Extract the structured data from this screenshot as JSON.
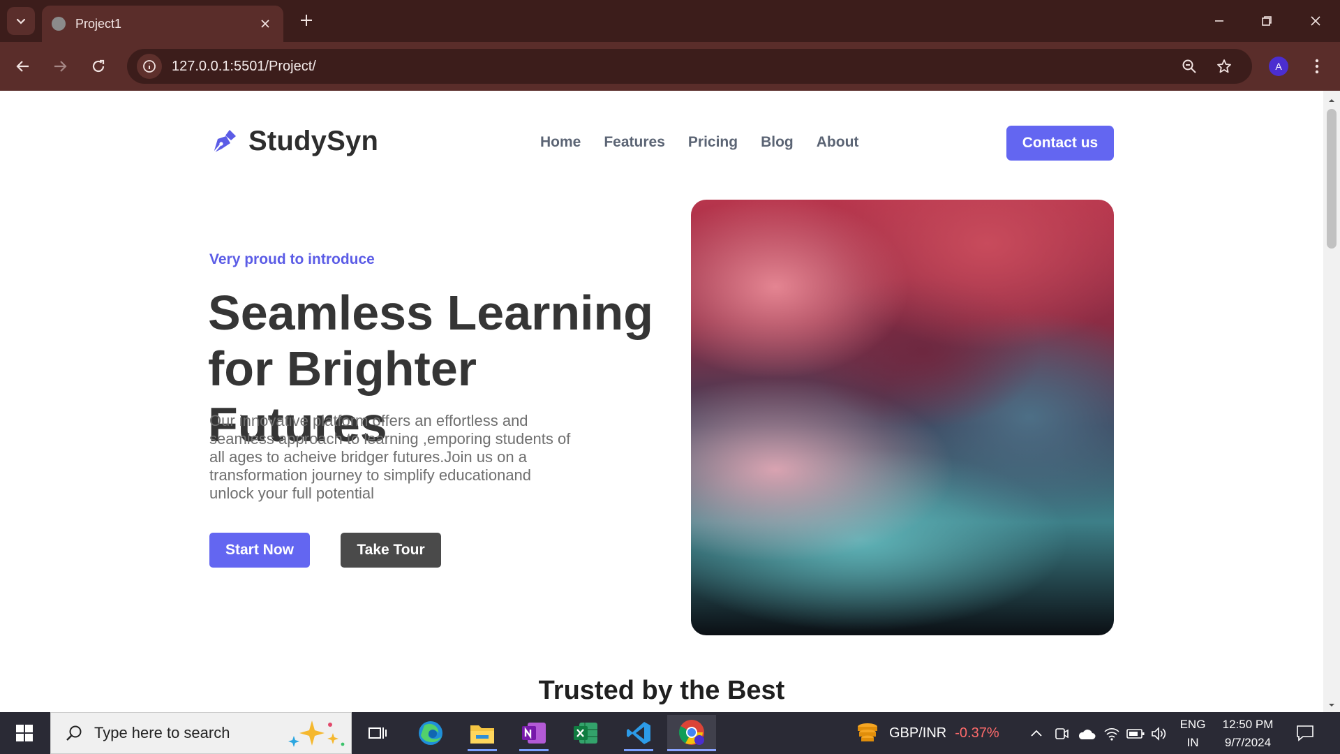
{
  "browser": {
    "tab_title": "Project1",
    "url": "127.0.0.1:5501/Project/",
    "profile_initial": "A"
  },
  "site": {
    "brand": "StudySyn",
    "nav": [
      "Home",
      "Features",
      "Pricing",
      "Blog",
      "About"
    ],
    "contact_label": "Contact us",
    "hero": {
      "eyebrow": "Very proud to introduce",
      "title_line1": "Seamless Learning",
      "title_line2": "for Brighter Futures",
      "description": "Our innovative platform offers an effortless and seamless approach to learning ,emporing students of all ages to acheive bridger futures.Join us on a transformation journey to simplify educationand unlock your full potential",
      "start_label": "Start Now",
      "tour_label": "Take Tour"
    },
    "section_title": "Trusted by the Best",
    "colors": {
      "accent": "#6366f1",
      "dark_button": "#4a4a4a",
      "heading": "#353535"
    }
  },
  "taskbar": {
    "search_placeholder": "Type here to search",
    "widget_label": "GBP/INR",
    "widget_change": "-0.37%",
    "lang_top": "ENG",
    "lang_bottom": "IN",
    "time": "12:50 PM",
    "date": "9/7/2024",
    "apps": [
      "task-view-icon",
      "edge-icon",
      "file-explorer-icon",
      "onenote-icon",
      "excel-icon",
      "vscode-icon",
      "chrome-icon"
    ]
  },
  "colors": {
    "titlebar": "#3c1d1b",
    "toolbar": "#5a2d2a",
    "taskbar": "#2a2a35"
  }
}
